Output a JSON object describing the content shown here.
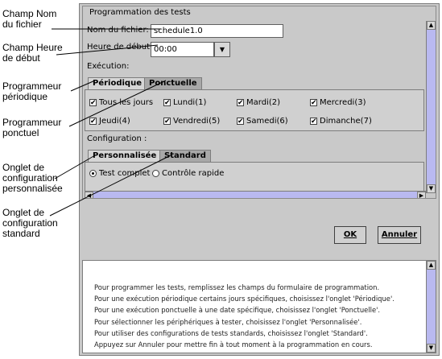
{
  "callouts": {
    "filename": [
      "Champ Nom",
      "du fichier"
    ],
    "start_time": [
      "Champ Heure",
      "de début"
    ],
    "periodic": [
      "Programmeur",
      "périodique"
    ],
    "oneshot": [
      "Programmeur",
      "ponctuel"
    ],
    "custom_tab": [
      "Onglet de",
      "configuration",
      "personnalisée"
    ],
    "standard_tab": [
      "Onglet de",
      "configuration",
      "standard"
    ]
  },
  "group_title": "Programmation des tests",
  "form": {
    "filename_label": "Nom du fichier:",
    "filename_value": "schedule1.0",
    "start_label": "Heure de début:",
    "start_value": "00:00",
    "execution_label": "Exécution:",
    "config_label": "Configuration :"
  },
  "exec_tabs": [
    "Périodique",
    "Ponctuelle"
  ],
  "days": [
    {
      "label": "Tous les jours",
      "checked": true
    },
    {
      "label": "Lundi(1)",
      "checked": true
    },
    {
      "label": "Mardi(2)",
      "checked": true
    },
    {
      "label": "Mercredi(3)",
      "checked": true
    },
    {
      "label": "Jeudi(4)",
      "checked": true
    },
    {
      "label": "Vendredi(5)",
      "checked": true
    },
    {
      "label": "Samedi(6)",
      "checked": true
    },
    {
      "label": "Dimanche(7)",
      "checked": true
    }
  ],
  "config_tabs": [
    "Personnalisée",
    "Standard"
  ],
  "radios": [
    {
      "label": "Test complet",
      "selected": true
    },
    {
      "label": "Contrôle rapide",
      "selected": false
    }
  ],
  "buttons": {
    "ok": "OK",
    "cancel": "Annuler"
  },
  "help_lines": [
    "Pour programmer les tests, remplissez les champs du formulaire de programmation.",
    "Pour une exécution périodique certains jours spécifiques, choisissez l'onglet 'Périodique'.",
    "Pour une exécution ponctuelle à une date spécifique, choisissez l'onglet 'Ponctuelle'.",
    "Pour sélectionner les périphériques à tester, choisissez l'onglet 'Personnalisée'.",
    "Pour utiliser des configurations de tests standards, choisissez l'onglet 'Standard'.",
    "Appuyez sur Annuler pour mettre fin à tout moment à la programmation en cours."
  ],
  "icons": {
    "combo_arrow": "chevron-down-icon",
    "scroll_up": "arrow-up-icon",
    "scroll_down": "arrow-down-icon",
    "scroll_left": "arrow-left-icon",
    "scroll_right": "arrow-right-icon"
  },
  "colors": {
    "window_bg": "#c9c9c9",
    "scroll_track": "#b9b9f0",
    "help_bg": "#ffffff"
  }
}
